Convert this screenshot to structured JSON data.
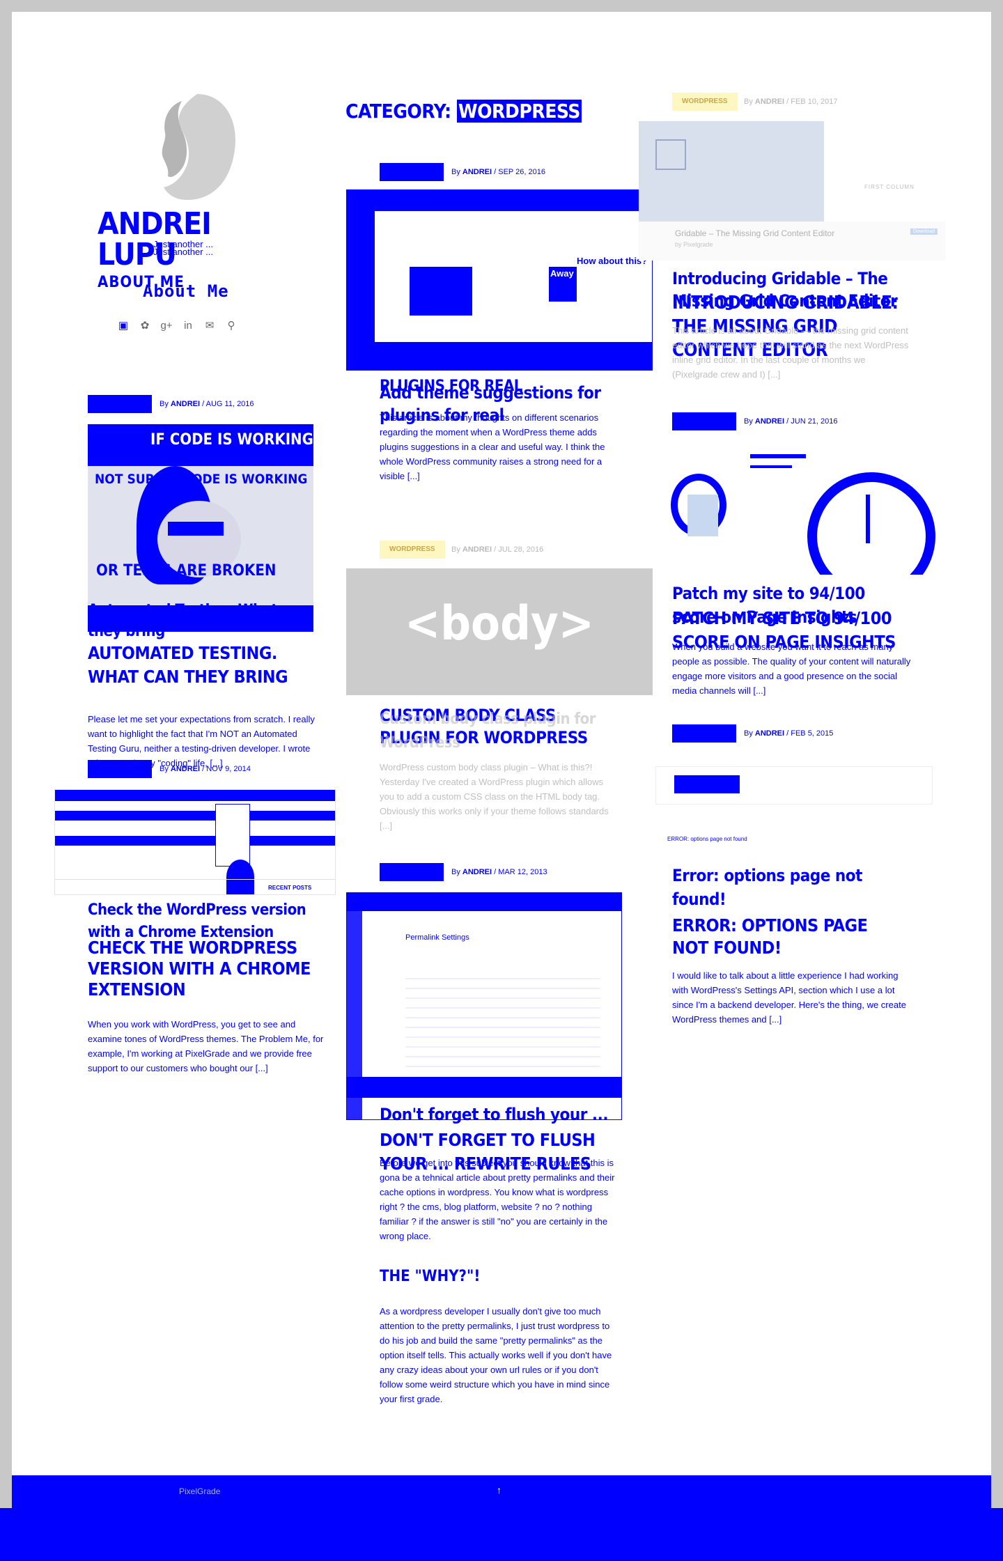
{
  "site": {
    "title": "ANDREI LUPU",
    "tagline": "Just another ...",
    "tagline2": "Just another ..."
  },
  "nav": {
    "about": "ABOUT ME",
    "about_alt": "About Me"
  },
  "social_icons": [
    "linkedin-square-icon",
    "twitter-icon",
    "google-plus-icon",
    "linkedin-icon",
    "email-icon",
    "search-icon"
  ],
  "category": {
    "label": "CATEGORY:",
    "name": "WORDPRESS"
  },
  "posts": [
    {
      "author_prefix": "By",
      "author": "ANDREI",
      "date": "AUG 11, 2016",
      "title": "AUTOMATED TESTING. WHAT CAN THEY BRING",
      "title_alt": "Automated Testing. What can they bring",
      "excerpt": "Please let me set your expectations from scratch. I really want to highlight the fact that I'm NOT an Automated Testing Guru, neither a testing-driven developer. I wrote a few tests in my \"coding\" life, [...]",
      "thumb_top": "IF CODE IS WORKING",
      "thumb_mid": "NOT SURE IF CODE IS WORKING",
      "thumb_bottom": "OR TESTS ARE BROKEN"
    },
    {
      "author_prefix": "By",
      "author": "ANDREI",
      "date": "NOV 9, 2014",
      "title": "CHECK THE WORDPRESS VERSION WITH A CHROME EXTENSION",
      "title_alt": "Check the WordPress version with a Chrome Extension",
      "excerpt": "When you work with WordPress, you get to see and examine tones of WordPress themes. The Problem Me, for example, I'm working at PixelGrade and we provide free support to our customers who bought our [...]",
      "thumb_footer": "RECENT POSTS"
    },
    {
      "author_prefix": "By",
      "author": "ANDREI",
      "date": "SEP 26, 2016",
      "title": "ADD THEME SUGGESTIONS FOR PLUGINS FOR REAL",
      "title_alt": "Add theme suggestions for plugins for real",
      "excerpt": "This article is about my thoughts on different scenarios regarding the moment when a WordPress theme adds plugins suggestions in a clear and useful way. I think the whole WordPress community raises a strong need for a visible [...]",
      "thumb_callout": "How about this?",
      "thumb_away": "Away"
    },
    {
      "badge": "WORDPRESS",
      "author_prefix": "By",
      "author": "ANDREI",
      "date": "JUL 28, 2016",
      "title": "CUSTOM BODY CLASS PLUGIN FOR WORDPRESS",
      "title_alt": "Custom body class plugin for WordPress",
      "excerpt": "WordPress custom body class plugin – What is this?! Yesterday I've created a WordPress plugin which allows you to add a custom CSS class on the HTML body tag. Obviously this works only if your theme follows standards [...]",
      "thumb_text": "<body>"
    },
    {
      "author_prefix": "By",
      "author": "ANDREI",
      "date": "MAR 12, 2013",
      "title": "DON'T FORGET TO FLUSH YOUR ... REWRITE RULES",
      "title_alt": "Don't forget to flush your ...",
      "excerpt": "Before we get into this subject you should know that this is gona be a tehnical article about pretty permalinks and their cache options in wordpress. You know what is wordpress right ? the cms, blog platform, website ? no ? nothing familiar ? if the answer is still \"no\" you are certainly in the wrong place.",
      "subheading": "THE \"WHY?\"!",
      "excerpt2": "As a wordpress developer I usually don't give too much attention to the pretty permalinks, I just trust wordpress to do his job and build the same \"pretty permalinks\" as the option itself tells. This actually works well if you don't have any crazy ideas about your own url rules or if you don't follow some weird structure which you have in mind since your first grade.",
      "thumb_title": "Permalink Settings"
    },
    {
      "badge": "WORDPRESS",
      "author_prefix": "By",
      "author": "ANDREI",
      "date": "FEB 10, 2017",
      "title": "INTRODUCING GRIDABLE: THE MISSING GRID CONTENT EDITOR",
      "title_alt": "Introducing Gridable – The Missing Grid Content Editor",
      "excerpt": "This article is all about Gridable — the missing grid content editor which we hope that will stand as the next WordPress inline grid editor. In the last couple of months we (Pixelgrade crew and I) [...]",
      "thumb_caption": "Gridable – The Missing Grid Content Editor",
      "thumb_sub": "by Pixelgrade",
      "thumb_btn": "Download",
      "thumb_col": "FIRST COLUMN"
    },
    {
      "author_prefix": "By",
      "author": "ANDREI",
      "date": "JUN 21, 2016",
      "title": "PATCH MY SITE TO 94/100 SCORE ON PAGE INSIGHTS",
      "title_alt": "Patch my site to 94/100 score on Page Insights",
      "excerpt": "When you build a website you want it to reach as many people as possible. The quality of your content will naturally engage more visitors and a good presence on the social media channels will [...]"
    },
    {
      "author_prefix": "By",
      "author": "ANDREI",
      "date": "FEB 5, 2015",
      "title": "ERROR: OPTIONS PAGE NOT FOUND!",
      "title_alt": "Error: options page not found!",
      "excerpt": "I would like to talk about a little experience I had working with WordPress's Settings API, section which I use a lot since I'm a backend developer. Here's the thing, we create WordPress themes and [...]",
      "thumb_text": "ERROR: options page not found"
    }
  ],
  "footer": {
    "credit": "PixelGrade",
    "back_to_top": "↑"
  },
  "colors": {
    "accent": "#0000ff",
    "badge_pale": "#fff7c2",
    "gray": "#c8c8c8"
  }
}
